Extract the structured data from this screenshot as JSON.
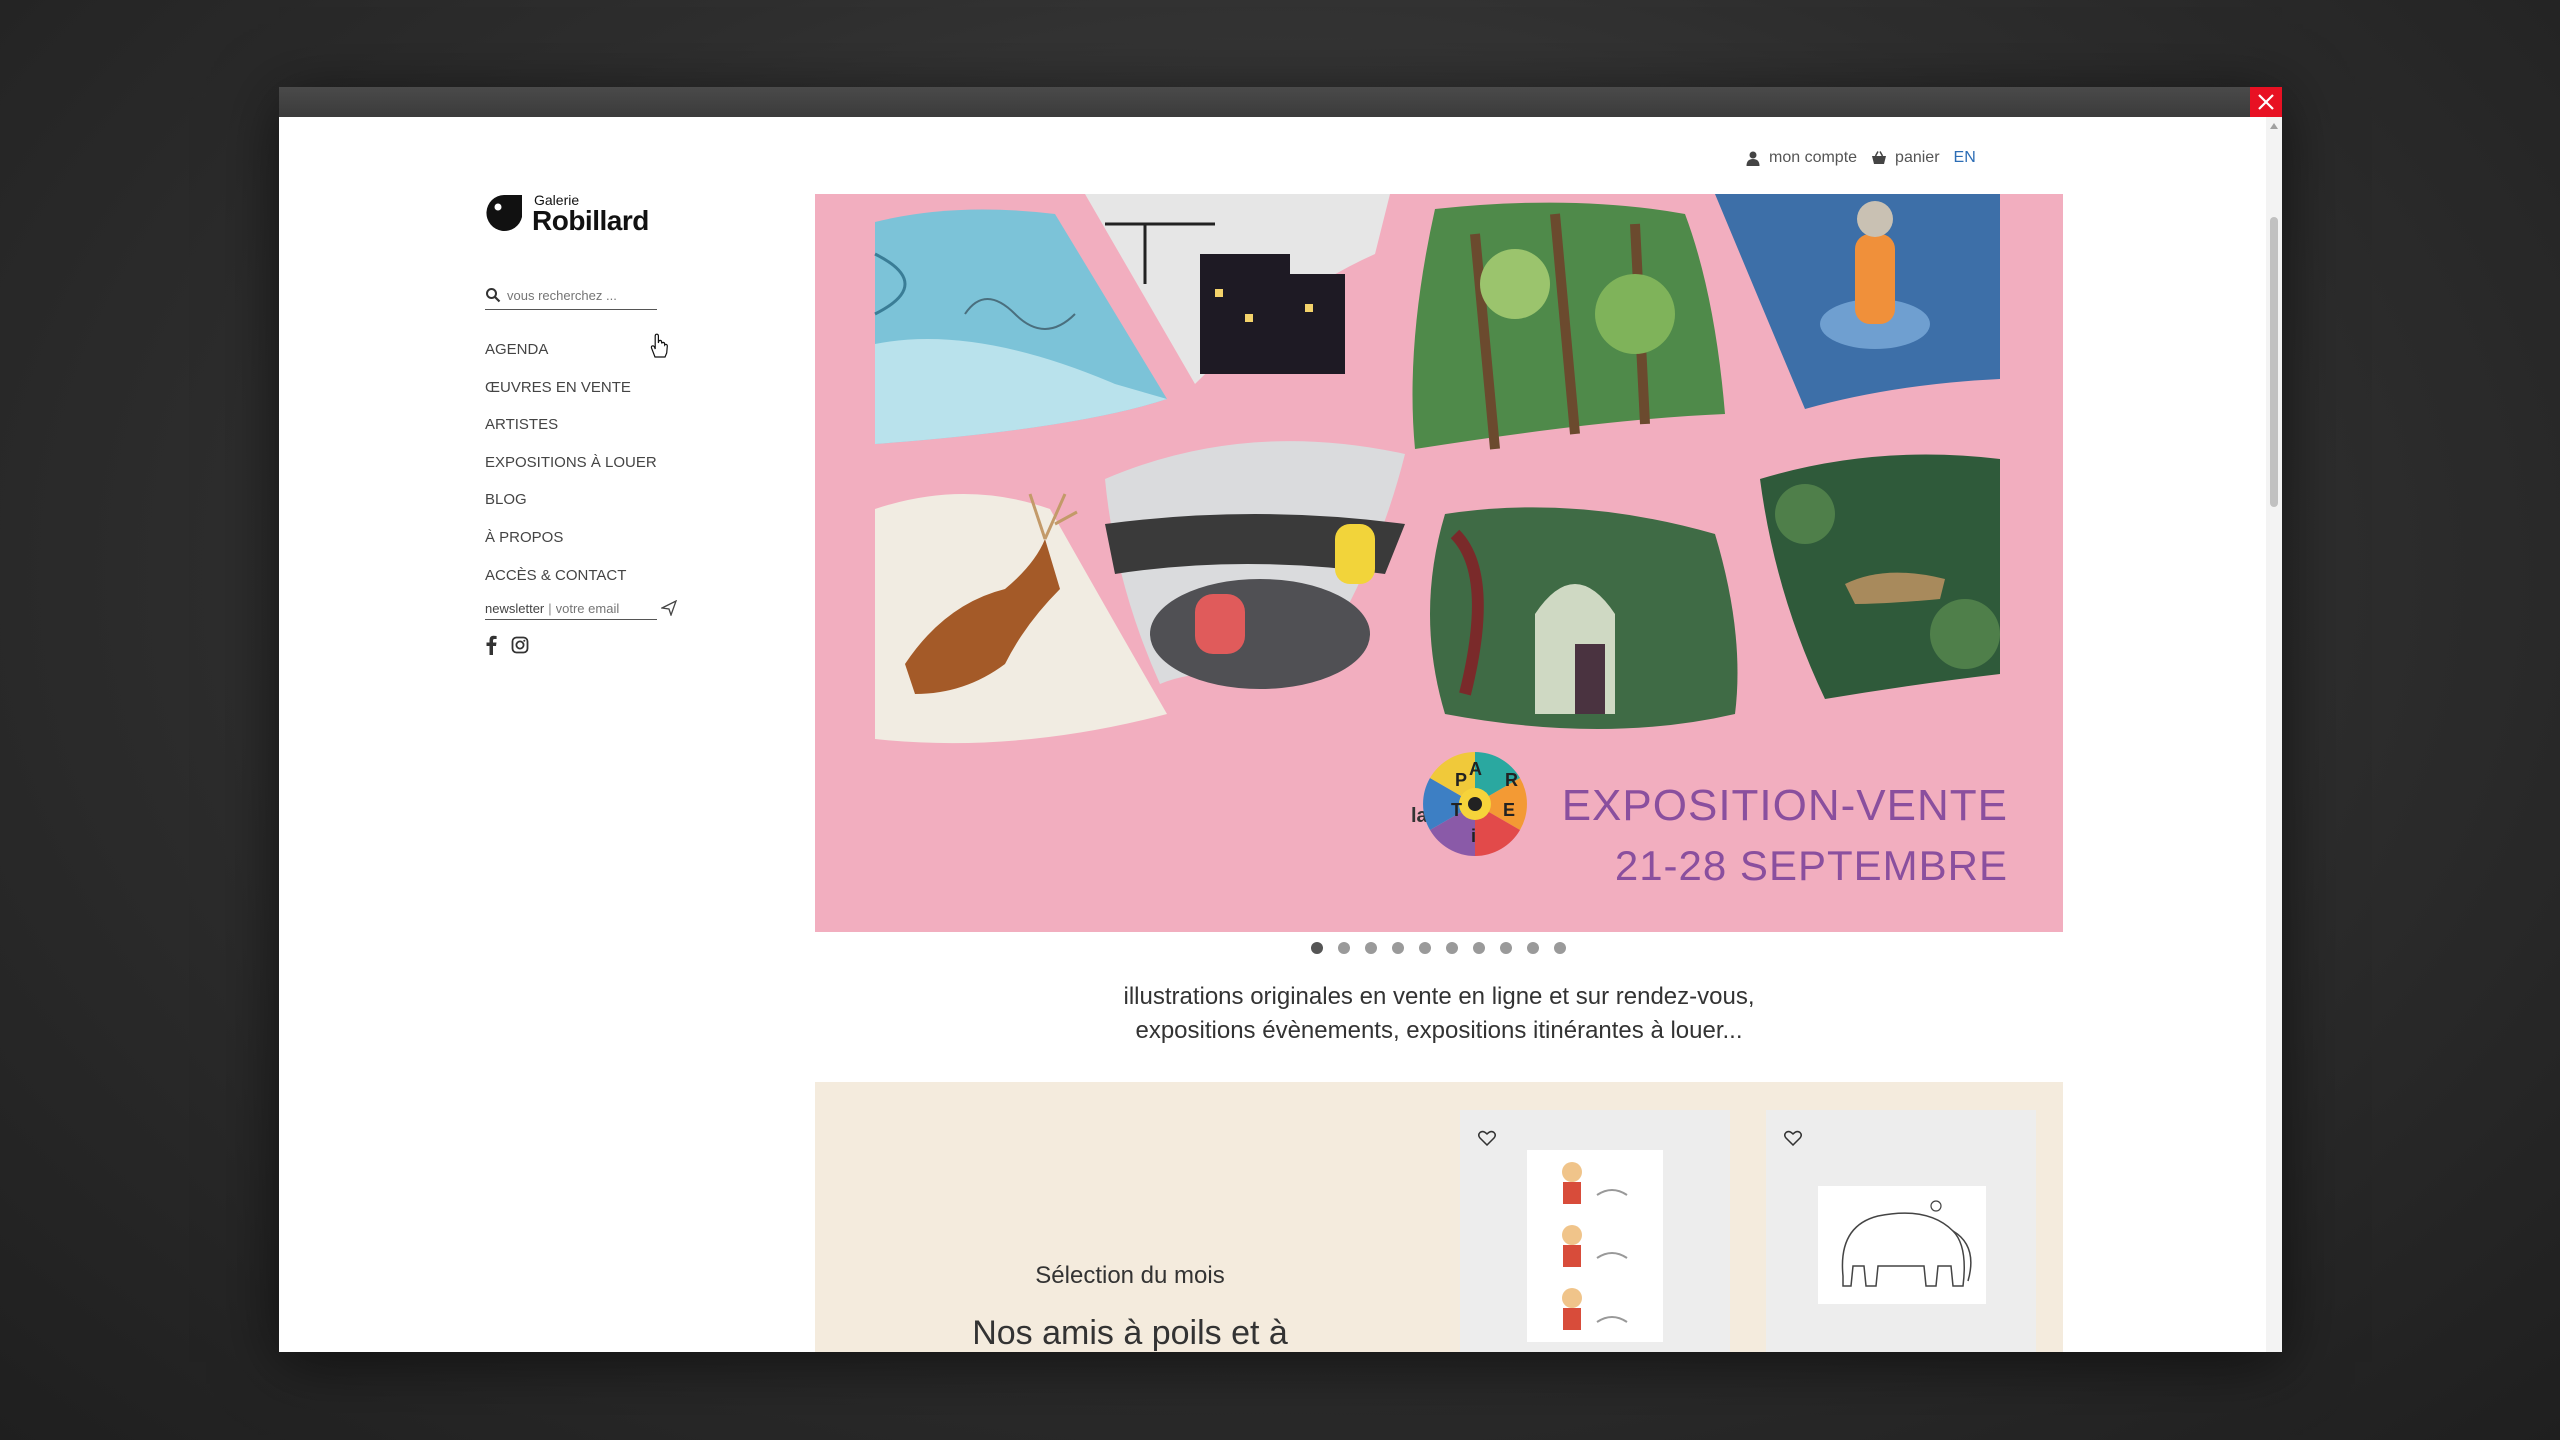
{
  "header": {
    "account_label": "mon compte",
    "cart_label": "panier",
    "lang_label": "EN"
  },
  "logo": {
    "small": "Galerie",
    "big": "Robillard"
  },
  "search": {
    "placeholder": "vous recherchez ..."
  },
  "sidebar": {
    "items": [
      {
        "label": "AGENDA"
      },
      {
        "label": "ŒUVRES EN VENTE"
      },
      {
        "label": "ARTISTES"
      },
      {
        "label": "EXPOSITIONS À LOUER"
      },
      {
        "label": "BLOG"
      },
      {
        "label": "À PROPOS"
      },
      {
        "label": "ACCÈS & CONTACT"
      }
    ]
  },
  "newsletter": {
    "label": "newsletter",
    "separator": "|",
    "placeholder": "votre email"
  },
  "hero": {
    "headline": "EXPOSITION-VENTE",
    "dates": "21-28 SEPTEMBRE",
    "logo_la": "la",
    "logo_letters": [
      "P",
      "A",
      "R",
      "T",
      "i",
      "E"
    ],
    "slide_count": 10,
    "active_slide": 1
  },
  "tagline": {
    "line1": "illustrations originales en vente en ligne et sur rendez-vous,",
    "line2": "expositions évènements, expositions itinérantes à louer..."
  },
  "selection": {
    "title": "Sélection du mois",
    "name": "Nos amis à poils et à"
  },
  "colors": {
    "hero_pink": "#f2aebf",
    "headline_purple": "#8a4f9e",
    "selection_bg": "#f4ebdd"
  }
}
